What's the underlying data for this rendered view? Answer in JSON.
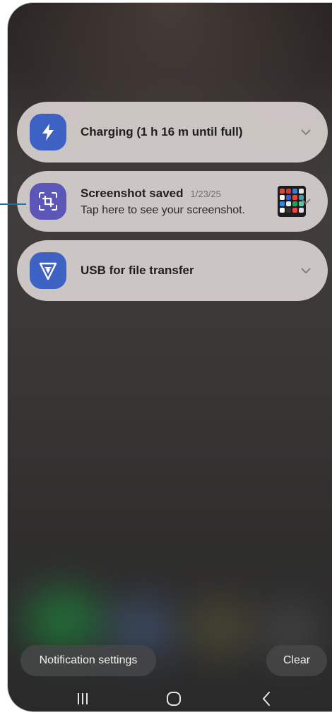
{
  "notifications": [
    {
      "title": "Charging (1 h 16 m until full)",
      "icon": "lightning-bolt-icon",
      "icon_color": "#3d62c4"
    },
    {
      "title": "Screenshot saved",
      "time": "1/23/25",
      "body": "Tap here to see your screenshot.",
      "icon": "screenshot-crop-icon",
      "icon_color": "#5b56b7"
    },
    {
      "title": "USB for file transfer",
      "icon": "usb-shield-icon",
      "icon_color": "#3d62c4"
    }
  ],
  "footer": {
    "settings_label": "Notification settings",
    "clear_label": "Clear"
  },
  "navbar": {
    "recents": "recent-apps-icon",
    "home": "home-icon",
    "back": "back-icon"
  },
  "colors": {
    "callout": "#1f6fa0",
    "notification_bg": "#d6d0cd",
    "icon_blue": "#3d62c4",
    "icon_purple": "#5b56b7"
  }
}
